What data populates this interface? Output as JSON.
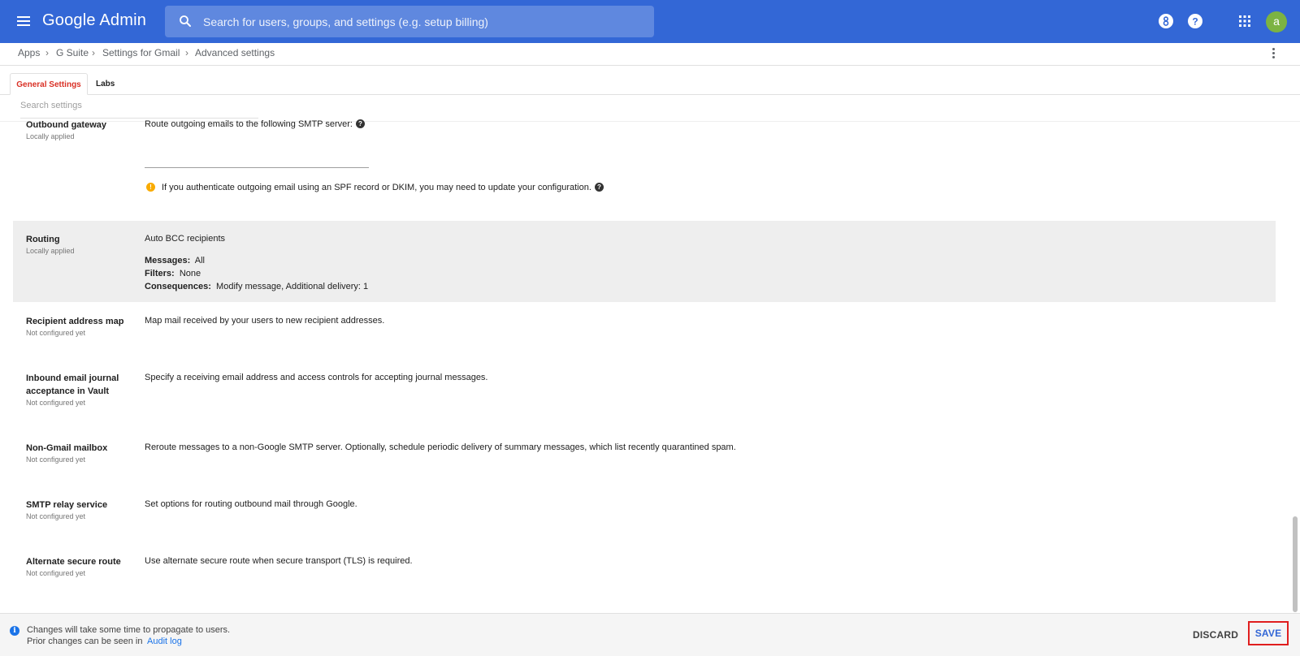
{
  "app": {
    "title": "Google Admin"
  },
  "search": {
    "placeholder": "Search for users, groups, and settings (e.g. setup billing)"
  },
  "header_icons": [
    "support-icon",
    "help-icon",
    "apps-grid-icon"
  ],
  "user": {
    "avatar_letter": "a",
    "avatar_color": "#7cb342"
  },
  "breadcrumb": [
    "Apps",
    "G Suite",
    "Settings for Gmail",
    "Advanced settings"
  ],
  "tabs": [
    {
      "label": "General Settings",
      "active": true
    },
    {
      "label": "Labs",
      "active": false
    }
  ],
  "settings_search": {
    "placeholder": "Search settings"
  },
  "settings": {
    "outbound_gateway": {
      "title": "Outbound gateway",
      "status": "Locally applied",
      "description": "Route outgoing emails to the following SMTP server:",
      "warning": "If you authenticate outgoing email using an SPF record or DKIM, you may need to update your configuration."
    },
    "routing": {
      "title": "Routing",
      "status": "Locally applied",
      "rule_name": "Auto BCC recipients",
      "messages_label": "Messages:",
      "messages_value": "All",
      "filters_label": "Filters:",
      "filters_value": "None",
      "consequences_label": "Consequences:",
      "consequences_value": "Modify message, Additional delivery: 1"
    },
    "recipient_address_map": {
      "title": "Recipient address map",
      "status": "Not configured yet",
      "description": "Map mail received by your users to new recipient addresses."
    },
    "inbound_journal": {
      "title_line1": "Inbound email journal",
      "title_line2": "acceptance in Vault",
      "status": "Not configured yet",
      "description": "Specify a receiving email address and access controls for accepting journal messages."
    },
    "non_gmail_mailbox": {
      "title": "Non-Gmail mailbox",
      "status": "Not configured yet",
      "description": "Reroute messages to a non-Google SMTP server. Optionally, schedule periodic delivery of summary messages, which list recently quarantined spam."
    },
    "smtp_relay": {
      "title": "SMTP relay service",
      "status": "Not configured yet",
      "description": "Set options for routing outbound mail through Google."
    },
    "alternate_secure_route": {
      "title": "Alternate secure route",
      "status": "Not configured yet",
      "description": "Use alternate secure route when secure transport (TLS) is required."
    }
  },
  "footer": {
    "line1": "Changes will take some time to propagate to users.",
    "line2": "Prior changes can be seen in",
    "audit_link": "Audit log",
    "discard_label": "DISCARD",
    "save_label": "SAVE"
  },
  "colors": {
    "appbar": "#3367d6",
    "active_tab": "#d93025",
    "warning": "#f9ab00",
    "link": "#1a73e8",
    "save_highlight": "#e01e1e"
  }
}
